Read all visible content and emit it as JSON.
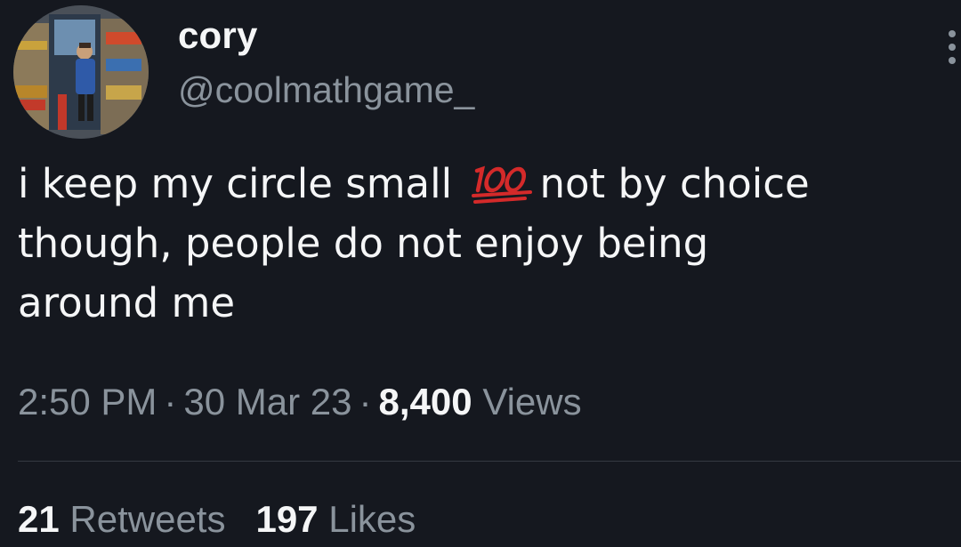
{
  "tweet": {
    "author": {
      "display_name": "cory",
      "handle": "@coolmathgame_",
      "avatar_icon": "profile-photo"
    },
    "more_icon": "more-vertical-icon",
    "text": {
      "line1_before_emoji": "i keep my circle small ",
      "emoji_icon": "hundred-points-emoji",
      "line1_after_emoji": "not by choice",
      "line2": "though, people do not enjoy being",
      "line3": "around me"
    },
    "meta": {
      "time": "2:50 PM",
      "separator": "·",
      "date": "30 Mar 23",
      "views_count": "8,400",
      "views_label": "Views"
    },
    "stats": {
      "retweets_count": "21",
      "retweets_label": "Retweets",
      "likes_count": "197",
      "likes_label": "Likes"
    },
    "colors": {
      "background": "#15181f",
      "primary_text": "#f5f6f7",
      "secondary_text": "#8a939c",
      "divider": "#343941",
      "emoji_red": "#d42a2a"
    }
  }
}
